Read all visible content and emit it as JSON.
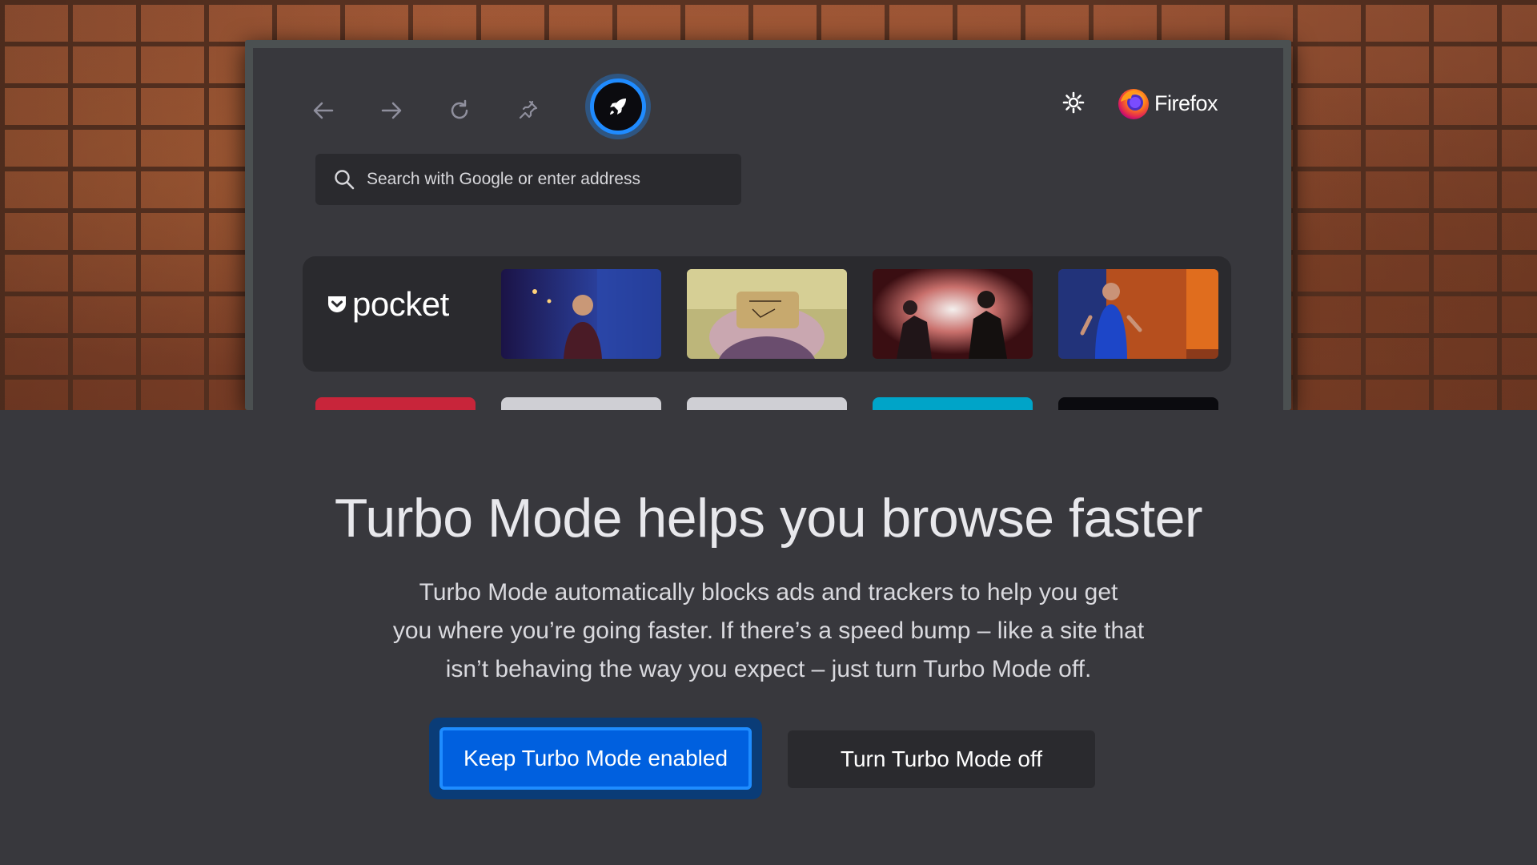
{
  "browser": {
    "brand_name": "Firefox",
    "search": {
      "placeholder": "Search with Google or enter address"
    },
    "nav_icons": [
      "back-arrow-icon",
      "forward-arrow-icon",
      "reload-icon",
      "pin-icon"
    ],
    "turbo_icon": "rocket-icon",
    "pocket_label": "pocket",
    "pocket_thumbnails": [
      "speaker-on-stage",
      "vr-headset-viewer",
      "firefighters-in-rain",
      "speaker-in-blue-dress"
    ],
    "tile_colors": [
      "#c8253a",
      "#cfcfd4",
      "#cfcfd4",
      "#00a4c8",
      "#0b0b0f"
    ]
  },
  "dialog": {
    "title": "Turbo Mode helps you browse faster",
    "description_lines": [
      "Turbo Mode automatically blocks ads and trackers to help you get",
      "you where you’re going faster. If there’s a speed bump – like a site that",
      "isn’t behaving the way you expect – just turn Turbo Mode off."
    ],
    "primary_button": "Keep Turbo Mode enabled",
    "secondary_button": "Turn Turbo Mode off"
  },
  "colors": {
    "accent": "#0060df",
    "accent_ring": "#1e8cff",
    "background": "#38383d",
    "surface": "#2a2a2e"
  }
}
